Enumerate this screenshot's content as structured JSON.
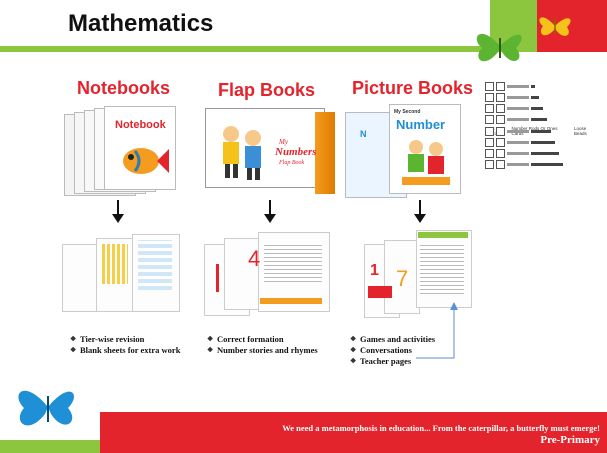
{
  "title": "Mathematics",
  "colors": {
    "green": "#8cc63f",
    "red": "#e4242c"
  },
  "sections": [
    {
      "heading": "Notebooks",
      "cover_word": "Notebook",
      "bullets": [
        "Tier-wise revision",
        "Blank sheets for extra work"
      ]
    },
    {
      "heading": "Flap Books",
      "cover_word": "Numbers",
      "cover_sub": "Flap Book",
      "cover_my": "My",
      "bullets": [
        "Correct formation",
        "Number stories and rhymes"
      ]
    },
    {
      "heading": "Picture Books",
      "cover_word": "Number",
      "cover_my": "My Second",
      "bullets": [
        "Games and activities",
        "Conversations",
        "Teacher pages"
      ]
    }
  ],
  "diagram_labels": [
    "Tens Board",
    "Number Rods Or Ones Cards",
    "Loose Beads"
  ],
  "footer": {
    "quote": "We need a metamorphosis in education... From the caterpillar, a butterfly must emerge!",
    "label": "Pre-Primary"
  }
}
